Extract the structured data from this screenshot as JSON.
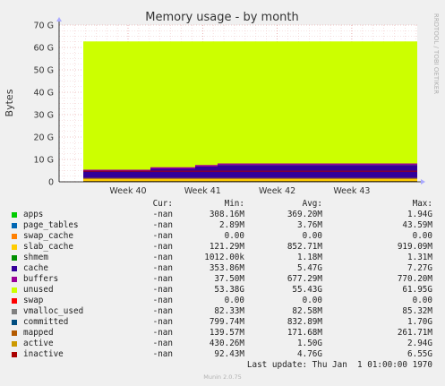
{
  "chart_data": {
    "type": "area",
    "title": "Memory usage - by month",
    "ylabel": "Bytes",
    "side_text": "RRDTOOL / TOBI OETIKER",
    "ylim": [
      0,
      70
    ],
    "y_unit": "G",
    "y_ticks": [
      "0",
      "10 G",
      "20 G",
      "30 G",
      "40 G",
      "50 G",
      "60 G",
      "70 G"
    ],
    "x_ticks": [
      "Week 40",
      "Week 41",
      "Week 42",
      "Week 43"
    ],
    "grid": true,
    "data_start_week": 39.4,
    "stack_series": [
      {
        "name": "apps",
        "color": "#00cc00",
        "value_g": 0.37
      },
      {
        "name": "page_tables",
        "color": "#0066b3",
        "value_g": 0.004
      },
      {
        "name": "swap_cache",
        "color": "#ff8000",
        "value_g": 0.0
      },
      {
        "name": "slab_cache",
        "color": "#ffcc00",
        "value_g": 0.85
      },
      {
        "name": "cache",
        "color": "#330099",
        "steps": [
          {
            "week": 39.4,
            "g": 3.5
          },
          {
            "week": 40.3,
            "g": 4.6
          },
          {
            "week": 40.9,
            "g": 5.6
          },
          {
            "week": 41.2,
            "g": 6.3
          }
        ]
      },
      {
        "name": "buffers",
        "color": "#990099",
        "value_g": 0.68
      },
      {
        "name": "unused",
        "color": "#ccff00",
        "value_g": 55.4
      }
    ],
    "total_g": 62.7,
    "line_series": [
      {
        "name": "active",
        "color": "#cc9900",
        "value_g": 1.5
      },
      {
        "name": "inactive",
        "color": "#aa0000",
        "value_g": 4.76
      },
      {
        "name": "mapped",
        "color": "#b35a00",
        "value_g": 0.17
      }
    ]
  },
  "legend": {
    "headers": {
      "cur": "Cur:",
      "min": "Min:",
      "avg": "Avg:",
      "max": "Max:"
    },
    "rows": [
      {
        "name": "apps",
        "color": "#00cc00",
        "cur": "-nan",
        "min": "308.16M",
        "avg": "369.20M",
        "max": "1.94G"
      },
      {
        "name": "page_tables",
        "color": "#0066b3",
        "cur": "-nan",
        "min": "2.89M",
        "avg": "3.76M",
        "max": "43.59M"
      },
      {
        "name": "swap_cache",
        "color": "#ff8000",
        "cur": "-nan",
        "min": "0.00",
        "avg": "0.00",
        "max": "0.00"
      },
      {
        "name": "slab_cache",
        "color": "#ffcc00",
        "cur": "-nan",
        "min": "121.29M",
        "avg": "852.71M",
        "max": "919.09M"
      },
      {
        "name": "shmem",
        "color": "#008f00",
        "cur": "-nan",
        "min": "1012.00k",
        "avg": "1.18M",
        "max": "1.31M"
      },
      {
        "name": "cache",
        "color": "#330099",
        "cur": "-nan",
        "min": "353.86M",
        "avg": "5.47G",
        "max": "7.27G"
      },
      {
        "name": "buffers",
        "color": "#990099",
        "cur": "-nan",
        "min": "37.50M",
        "avg": "677.29M",
        "max": "770.20M"
      },
      {
        "name": "unused",
        "color": "#ccff00",
        "cur": "-nan",
        "min": "53.38G",
        "avg": "55.43G",
        "max": "61.95G"
      },
      {
        "name": "swap",
        "color": "#ff0000",
        "cur": "-nan",
        "min": "0.00",
        "avg": "0.00",
        "max": "0.00"
      },
      {
        "name": "vmalloc_used",
        "color": "#808080",
        "cur": "-nan",
        "min": "82.33M",
        "avg": "82.58M",
        "max": "85.32M"
      },
      {
        "name": "committed",
        "color": "#004d80",
        "cur": "-nan",
        "min": "799.74M",
        "avg": "832.89M",
        "max": "1.70G"
      },
      {
        "name": "mapped",
        "color": "#b35a00",
        "cur": "-nan",
        "min": "139.57M",
        "avg": "171.68M",
        "max": "261.71M"
      },
      {
        "name": "active",
        "color": "#cc9900",
        "cur": "-nan",
        "min": "430.26M",
        "avg": "1.50G",
        "max": "2.94G"
      },
      {
        "name": "inactive",
        "color": "#aa0000",
        "cur": "-nan",
        "min": "92.43M",
        "avg": "4.76G",
        "max": "6.55G"
      }
    ]
  },
  "last_update": "Last update: Thu Jan  1 01:00:00 1970",
  "footer": "Munin 2.0.75"
}
